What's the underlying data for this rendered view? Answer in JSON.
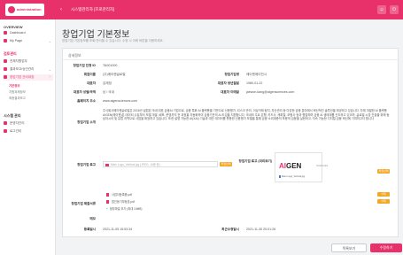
{
  "header": {
    "logo_text": "administration",
    "breadcrumb": "시스템관리자 [프로관리자]",
    "collapse_icon": "chevron-left-icon",
    "icons": [
      "user-icon",
      "logout-icon"
    ]
  },
  "sidebar": {
    "sections": [
      {
        "title": "OVERVIEW",
        "items": [
          {
            "label": "Dashboard"
          },
          {
            "label": "My Page"
          }
        ]
      },
      {
        "title": "검토관리",
        "items": [
          {
            "label": "전체지원업무"
          },
          {
            "label": "결과보고/승인관리"
          },
          {
            "label": "창업기업 관리대장"
          }
        ]
      },
      {
        "title": "시스템 관리",
        "items": [
          {
            "label": "운영자관리"
          },
          {
            "label": "로그관리"
          }
        ]
      }
    ],
    "sub_items": [
      "기본정보",
      "지원과제정보",
      "최종결과보고"
    ]
  },
  "page": {
    "title": "창업기업 기본정보",
    "subtitle": "창업기업 기본정보를 조회/관리할 수 있습니다. 수정 시 아래 버튼을 이용하세요."
  },
  "card": {
    "title": "상세정보"
  },
  "fields": {
    "company_id_label": "창업기업 인정 ID",
    "company_id": "TA001000",
    "company_name_label": "회원이름",
    "company_name": "(주)에이젠글로벌",
    "company_type_label": "창업기업명",
    "company_type": "에이젠에이전시",
    "ceo_label": "대표자",
    "ceo": "김재정",
    "birth_label": "대표자 생년월일",
    "birth": "1980-01-22",
    "biz_type_label": "대표자 성별/국적",
    "biz_type": "남 / 국내",
    "email_label": "대표자 이메일",
    "email": "jaewon.kang@aigensciences.com",
    "homepage_label": "홈페이지 주소",
    "homepage": "www.aigensciences.com",
    "intro_label": "창업기업 소개",
    "intro": "주식회사에이젠글로벌은 2016년 설립된 국내 대표 금융AI 기업으로, 금융 특화 AI 플랫폼을 기반으로 신용평가, 리스크 관리, 이상거래 탐지, 자산관리 등 다양한 금융 분야에서 혁신적인 솔루션을 제공하고 있습니다. 자체 개발한 AI 플랫폼 AIGEN(에이젠)은 데이터 수집부터 모델 개발, 배포, 운영까지 전 과정을 자동화하여 금융기관의 AI 도입을 지원합니다. 국내외 주요 은행, 카드사, 캐피탈, 보험사 등과 협업하며 금융 AI 생태계를 선도하고 있으며, 글로벌 시장 진출을 위해 동남아시아 및 유럽 지역으로 사업을 확장하고 있습니다. 또한 설명 가능한 AI(XAI) 기술과 대안 데이터를 활용한 신용평가 모델을 통해 금융 소외계층의 포용적 금융을 실현하고, 지속 가능한 디지털 금융 혁신에 기여하고자 합니다.",
    "logo_label": "창업기업 로고",
    "logo_input": "Main Logo_Vertical.jpg (JPEG, 16종 등)",
    "logo_button": "파일선택",
    "preview_label": "창업기업 로고 (미리보기)",
    "preview_brand_a": "AI",
    "preview_brand_b": "GEN",
    "preview_brand_suffix": "SCIENCES",
    "preview_file": "Main Logo_Vertical.jpg",
    "docs_label": "창업기업 제출서류",
    "doc1": "사업자등록증.pdf",
    "doc2": "법인등기부등본.pdf",
    "doc_delete": "삭제",
    "add_file": "첨부파일 추가 (최대 10MB)",
    "memo_label": "메모",
    "reg_date_label": "등록일시",
    "reg_date": "2021-11-05 15:53:34",
    "mod_date_label": "최근수정일시",
    "mod_date": "2021-11-30 20:01:26"
  },
  "footer": {
    "list_button": "목록보기",
    "edit_button": "수정하기"
  },
  "colors": {
    "accent": "#e8316a",
    "file_button": "#f5a623"
  }
}
